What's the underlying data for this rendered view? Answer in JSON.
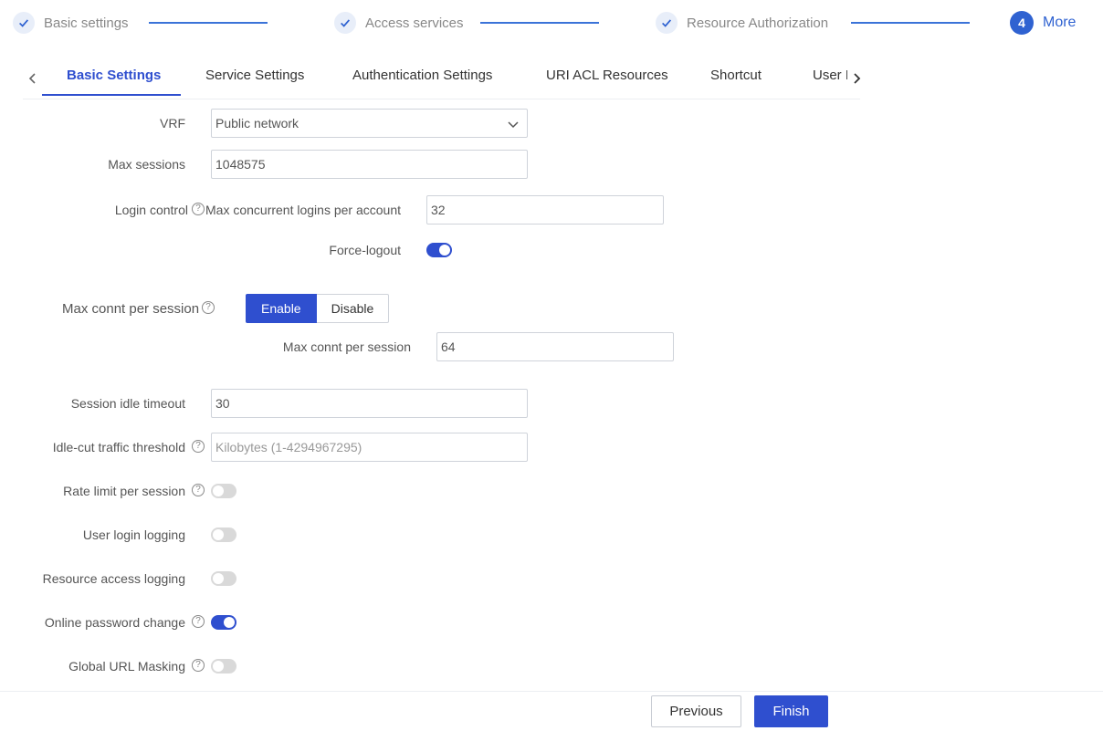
{
  "steps": [
    {
      "label": "Basic settings",
      "status": "done"
    },
    {
      "label": "Access services",
      "status": "done"
    },
    {
      "label": "Resource Authorization",
      "status": "done"
    },
    {
      "number": "4",
      "label": "More",
      "status": "active"
    }
  ],
  "tabs": {
    "items": [
      "Basic Settings",
      "Service Settings",
      "Authentication Settings",
      "URI ACL Resources",
      "Shortcut",
      "User M"
    ],
    "active": "Basic Settings"
  },
  "form": {
    "vrf": {
      "label": "VRF",
      "value": "Public network"
    },
    "max_sessions": {
      "label": "Max sessions",
      "value": "1048575"
    },
    "login_control": {
      "label": "Login control",
      "max_logins_label": "Max concurrent logins per account",
      "max_logins_value": "32",
      "force_logout_label": "Force-logout",
      "force_logout_on": true
    },
    "max_connt": {
      "label": "Max connt per session",
      "options": [
        "Enable",
        "Disable"
      ],
      "selected": "Enable",
      "sub_label": "Max connt per session",
      "sub_value": "64"
    },
    "session_idle_timeout": {
      "label": "Session idle timeout",
      "value": "30"
    },
    "idle_cut": {
      "label": "Idle-cut traffic threshold",
      "placeholder": "Kilobytes (1-4294967295)"
    },
    "toggles": [
      {
        "label": "Rate limit per session",
        "on": false,
        "help": true
      },
      {
        "label": "User login logging",
        "on": false,
        "help": false
      },
      {
        "label": "Resource access logging",
        "on": false,
        "help": false
      },
      {
        "label": "Online password change",
        "on": true,
        "help": true
      },
      {
        "label": "Global URL Masking",
        "on": false,
        "help": true
      }
    ],
    "help_glyph": "?"
  },
  "footer": {
    "previous": "Previous",
    "finish": "Finish"
  },
  "colors": {
    "accent": "#2f4fcf",
    "step_line": "#3b73d8"
  }
}
